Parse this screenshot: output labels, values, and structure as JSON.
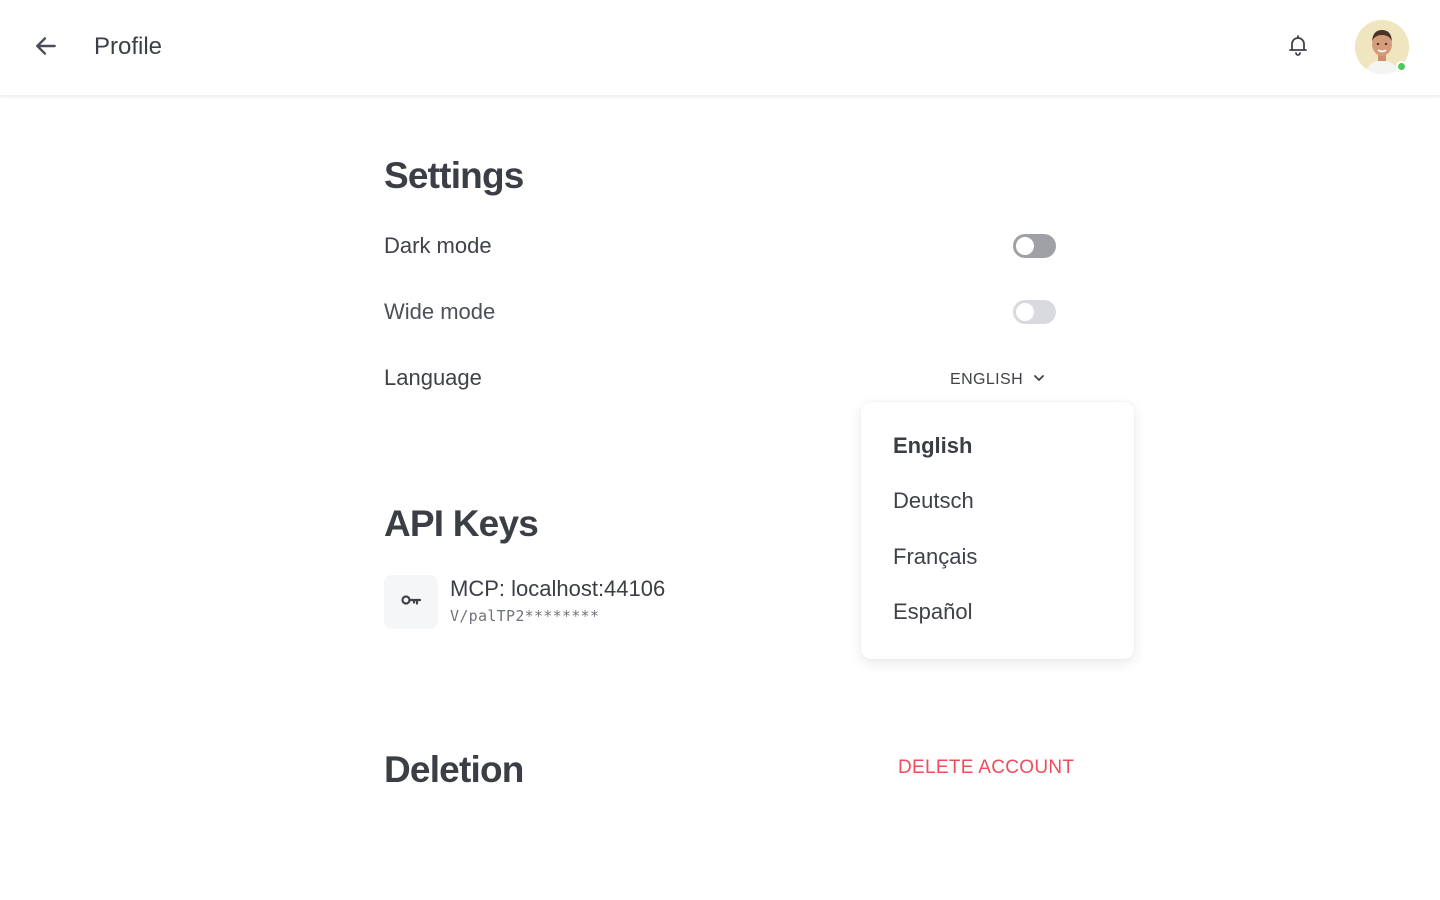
{
  "header": {
    "title": "Profile",
    "back_icon": "arrow-left-icon",
    "notification_icon": "bell-icon",
    "avatar_status_color": "#4cc95c"
  },
  "settings": {
    "heading": "Settings",
    "dark_mode": {
      "label": "Dark mode",
      "enabled": false
    },
    "wide_mode": {
      "label": "Wide mode",
      "enabled": false
    },
    "language": {
      "label": "Language",
      "selected": "ENGLISH",
      "options": [
        "English",
        "Deutsch",
        "Français",
        "Español"
      ],
      "selected_option": "English"
    }
  },
  "api_keys": {
    "heading": "API Keys",
    "items": [
      {
        "name": "MCP: localhost:44106",
        "masked_key": "V/palTP2********",
        "icon": "key-icon"
      }
    ]
  },
  "deletion": {
    "heading": "Deletion",
    "delete_label": "DELETE ACCOUNT",
    "delete_color": "#ef4c5c"
  }
}
